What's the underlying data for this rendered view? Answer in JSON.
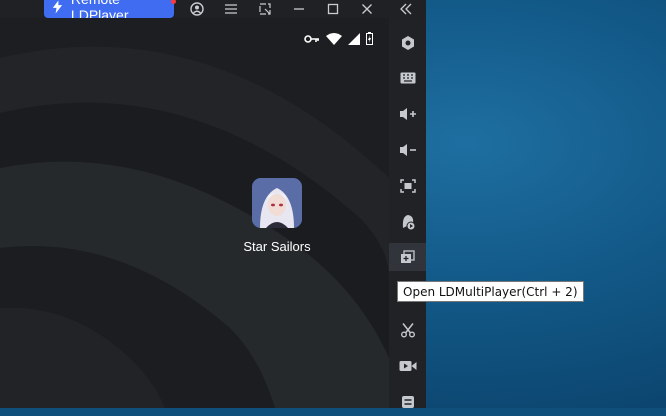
{
  "titlebar": {
    "remote_label": "Remote LDPlayer",
    "icons": [
      "bolt-icon",
      "user-icon",
      "menu-icon",
      "popout-icon",
      "minimize-icon",
      "maximize-icon",
      "close-icon",
      "collapse-icon"
    ]
  },
  "statusbar": {
    "icons": [
      "vpn-key-icon",
      "wifi-icon",
      "signal-icon",
      "battery-icon"
    ]
  },
  "home": {
    "apps": [
      {
        "label": "Star Sailors",
        "icon": "star-sailors-app-icon"
      }
    ]
  },
  "sidebar": {
    "items": [
      {
        "name": "hexagon-icon"
      },
      {
        "name": "keyboard-icon"
      },
      {
        "name": "volume-up-icon"
      },
      {
        "name": "volume-down-icon"
      },
      {
        "name": "fullscreen-icon"
      },
      {
        "name": "install-apk-icon"
      },
      {
        "name": "multi-instance-icon"
      },
      {
        "name": "scissors-icon"
      },
      {
        "name": "record-icon"
      },
      {
        "name": "more-icon"
      }
    ]
  },
  "tooltip": {
    "text": "Open LDMultiPlayer(Ctrl + 2)"
  },
  "colors": {
    "accent": "#3f6cf0",
    "sidebar_bg": "#202226",
    "screen_bg": "#1c1e21",
    "desktop": "#135b8a"
  }
}
